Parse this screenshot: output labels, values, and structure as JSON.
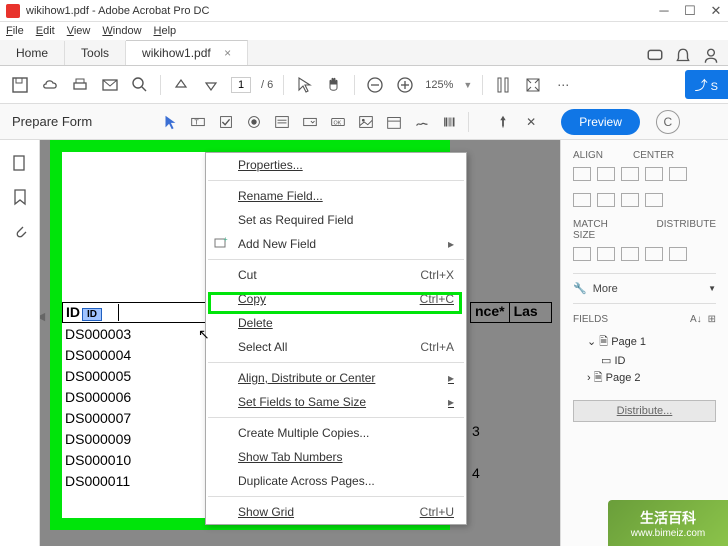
{
  "titlebar": {
    "text": "wikihow1.pdf - Adobe Acrobat Pro DC"
  },
  "menubar": [
    "File",
    "Edit",
    "View",
    "Window",
    "Help"
  ],
  "tabs": {
    "home": "Home",
    "tools": "Tools",
    "doc": "wikihow1.pdf"
  },
  "toolbar": {
    "page_current": "1",
    "page_total": "/ 6",
    "zoom": "125%",
    "share": "S"
  },
  "formbar": {
    "title": "Prepare Form",
    "preview": "Preview",
    "close": "C"
  },
  "context_menu": {
    "properties": "Properties...",
    "rename": "Rename Field...",
    "required": "Set as Required Field",
    "addnew": "Add New Field",
    "cut": "Cut",
    "cut_sc": "Ctrl+X",
    "copy": "Copy",
    "copy_sc": "Ctrl+C",
    "delete": "Delete",
    "selectall": "Select All",
    "selectall_sc": "Ctrl+A",
    "align": "Align, Distribute or Center",
    "samesize": "Set Fields to Same Size",
    "multiple": "Create Multiple Copies...",
    "tabnum": "Show Tab Numbers",
    "duplicate": "Duplicate Across Pages...",
    "grid": "Show Grid",
    "grid_sc": "Ctrl+U"
  },
  "document": {
    "header_id": "ID",
    "header_badge": "ID",
    "header_other": "nce*",
    "header_last": "Las",
    "rows": [
      "DS000003",
      "DS000004",
      "DS000005",
      "DS000006",
      "DS000007",
      "DS000009",
      "DS000010",
      "DS000011"
    ],
    "col2": [
      "",
      "",
      "",
      "3",
      "",
      "4",
      "",
      ""
    ]
  },
  "right_panel": {
    "align": "ALIGN",
    "center": "CENTER",
    "match": "MATCH SIZE",
    "dist": "DISTRIBUTE",
    "more": "More",
    "fields": "FIELDS",
    "page1": "Page 1",
    "id_field": "ID",
    "page2": "Page 2",
    "distribute_btn": "Distribute..."
  },
  "watermark": {
    "top": "生活百科",
    "url": "www.bimeiz.com"
  }
}
